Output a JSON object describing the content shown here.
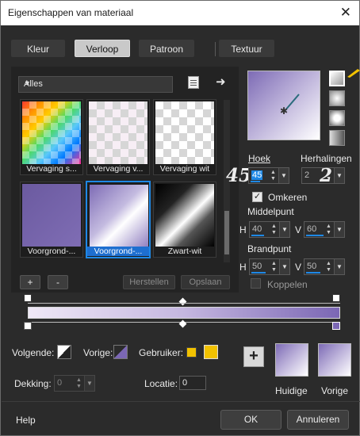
{
  "window": {
    "title": "Eigenschappen van materiaal",
    "close_glyph": "✕"
  },
  "tabs": [
    {
      "label": "Kleur"
    },
    {
      "label": "Verloop",
      "active": true
    },
    {
      "label": "Patroon"
    },
    {
      "label": "Textuur"
    }
  ],
  "library": {
    "category": "Alles",
    "thumbnails": [
      {
        "label": "Vervaging s..."
      },
      {
        "label": "Vervaging v..."
      },
      {
        "label": "Vervaging wit"
      },
      {
        "label": "Voorgrond-..."
      },
      {
        "label": "Voorgrond-...",
        "selected": true
      },
      {
        "label": "Zwart-wit"
      }
    ],
    "add_label": "+",
    "remove_label": "-",
    "reset_label": "Herstellen",
    "save_label": "Opslaan"
  },
  "settings": {
    "angle_label": "Hoek",
    "angle_value": "45",
    "angle_big": "45",
    "repeats_label": "Herhalingen",
    "repeats_value": "2",
    "repeats_big": "2",
    "invert_label": "Omkeren",
    "invert_checked": true,
    "center_label": "Middelpunt",
    "center_h_label": "H",
    "center_h": "40",
    "center_v_label": "V",
    "center_v": "60",
    "focal_label": "Brandpunt",
    "focal_h_label": "H",
    "focal_h": "50",
    "focal_v_label": "V",
    "focal_v": "50",
    "link_label": "Koppelen",
    "link_checked": false
  },
  "editor": {
    "next_label": "Volgende:",
    "prev_label": "Vorige:",
    "user_label": "Gebruiker:",
    "opacity_label": "Dekking:",
    "opacity_value": "0",
    "location_label": "Locatie:",
    "location_value": "0"
  },
  "swatches": {
    "current_label": "Huidige",
    "previous_label": "Vorige",
    "add_glyph": "+"
  },
  "colors": {
    "gradient_start": "#efe8f6",
    "gradient_end": "#7b67b4",
    "user_swatch": "#f2c200",
    "accent": "#1e88e5"
  },
  "footer": {
    "help_label": "Help",
    "ok_label": "OK",
    "cancel_label": "Annuleren"
  }
}
